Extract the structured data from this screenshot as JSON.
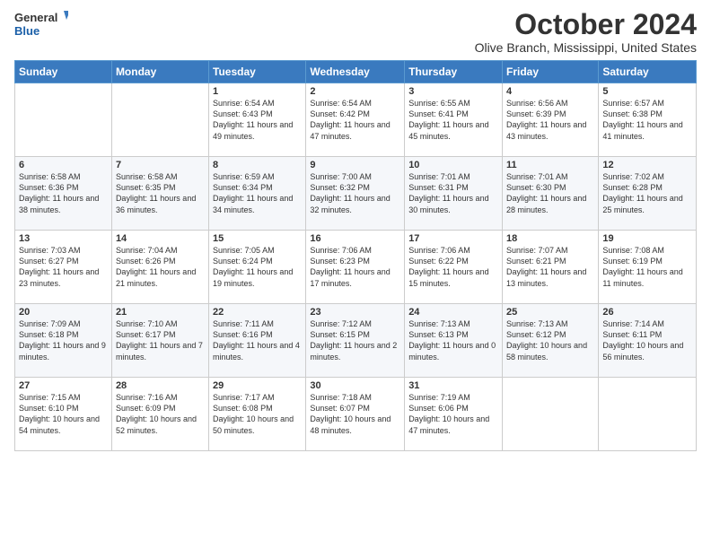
{
  "header": {
    "logo_line1": "General",
    "logo_line2": "Blue",
    "month": "October 2024",
    "location": "Olive Branch, Mississippi, United States"
  },
  "weekdays": [
    "Sunday",
    "Monday",
    "Tuesday",
    "Wednesday",
    "Thursday",
    "Friday",
    "Saturday"
  ],
  "weeks": [
    [
      {
        "day": "",
        "sunrise": "",
        "sunset": "",
        "daylight": ""
      },
      {
        "day": "",
        "sunrise": "",
        "sunset": "",
        "daylight": ""
      },
      {
        "day": "1",
        "sunrise": "Sunrise: 6:54 AM",
        "sunset": "Sunset: 6:43 PM",
        "daylight": "Daylight: 11 hours and 49 minutes."
      },
      {
        "day": "2",
        "sunrise": "Sunrise: 6:54 AM",
        "sunset": "Sunset: 6:42 PM",
        "daylight": "Daylight: 11 hours and 47 minutes."
      },
      {
        "day": "3",
        "sunrise": "Sunrise: 6:55 AM",
        "sunset": "Sunset: 6:41 PM",
        "daylight": "Daylight: 11 hours and 45 minutes."
      },
      {
        "day": "4",
        "sunrise": "Sunrise: 6:56 AM",
        "sunset": "Sunset: 6:39 PM",
        "daylight": "Daylight: 11 hours and 43 minutes."
      },
      {
        "day": "5",
        "sunrise": "Sunrise: 6:57 AM",
        "sunset": "Sunset: 6:38 PM",
        "daylight": "Daylight: 11 hours and 41 minutes."
      }
    ],
    [
      {
        "day": "6",
        "sunrise": "Sunrise: 6:58 AM",
        "sunset": "Sunset: 6:36 PM",
        "daylight": "Daylight: 11 hours and 38 minutes."
      },
      {
        "day": "7",
        "sunrise": "Sunrise: 6:58 AM",
        "sunset": "Sunset: 6:35 PM",
        "daylight": "Daylight: 11 hours and 36 minutes."
      },
      {
        "day": "8",
        "sunrise": "Sunrise: 6:59 AM",
        "sunset": "Sunset: 6:34 PM",
        "daylight": "Daylight: 11 hours and 34 minutes."
      },
      {
        "day": "9",
        "sunrise": "Sunrise: 7:00 AM",
        "sunset": "Sunset: 6:32 PM",
        "daylight": "Daylight: 11 hours and 32 minutes."
      },
      {
        "day": "10",
        "sunrise": "Sunrise: 7:01 AM",
        "sunset": "Sunset: 6:31 PM",
        "daylight": "Daylight: 11 hours and 30 minutes."
      },
      {
        "day": "11",
        "sunrise": "Sunrise: 7:01 AM",
        "sunset": "Sunset: 6:30 PM",
        "daylight": "Daylight: 11 hours and 28 minutes."
      },
      {
        "day": "12",
        "sunrise": "Sunrise: 7:02 AM",
        "sunset": "Sunset: 6:28 PM",
        "daylight": "Daylight: 11 hours and 25 minutes."
      }
    ],
    [
      {
        "day": "13",
        "sunrise": "Sunrise: 7:03 AM",
        "sunset": "Sunset: 6:27 PM",
        "daylight": "Daylight: 11 hours and 23 minutes."
      },
      {
        "day": "14",
        "sunrise": "Sunrise: 7:04 AM",
        "sunset": "Sunset: 6:26 PM",
        "daylight": "Daylight: 11 hours and 21 minutes."
      },
      {
        "day": "15",
        "sunrise": "Sunrise: 7:05 AM",
        "sunset": "Sunset: 6:24 PM",
        "daylight": "Daylight: 11 hours and 19 minutes."
      },
      {
        "day": "16",
        "sunrise": "Sunrise: 7:06 AM",
        "sunset": "Sunset: 6:23 PM",
        "daylight": "Daylight: 11 hours and 17 minutes."
      },
      {
        "day": "17",
        "sunrise": "Sunrise: 7:06 AM",
        "sunset": "Sunset: 6:22 PM",
        "daylight": "Daylight: 11 hours and 15 minutes."
      },
      {
        "day": "18",
        "sunrise": "Sunrise: 7:07 AM",
        "sunset": "Sunset: 6:21 PM",
        "daylight": "Daylight: 11 hours and 13 minutes."
      },
      {
        "day": "19",
        "sunrise": "Sunrise: 7:08 AM",
        "sunset": "Sunset: 6:19 PM",
        "daylight": "Daylight: 11 hours and 11 minutes."
      }
    ],
    [
      {
        "day": "20",
        "sunrise": "Sunrise: 7:09 AM",
        "sunset": "Sunset: 6:18 PM",
        "daylight": "Daylight: 11 hours and 9 minutes."
      },
      {
        "day": "21",
        "sunrise": "Sunrise: 7:10 AM",
        "sunset": "Sunset: 6:17 PM",
        "daylight": "Daylight: 11 hours and 7 minutes."
      },
      {
        "day": "22",
        "sunrise": "Sunrise: 7:11 AM",
        "sunset": "Sunset: 6:16 PM",
        "daylight": "Daylight: 11 hours and 4 minutes."
      },
      {
        "day": "23",
        "sunrise": "Sunrise: 7:12 AM",
        "sunset": "Sunset: 6:15 PM",
        "daylight": "Daylight: 11 hours and 2 minutes."
      },
      {
        "day": "24",
        "sunrise": "Sunrise: 7:13 AM",
        "sunset": "Sunset: 6:13 PM",
        "daylight": "Daylight: 11 hours and 0 minutes."
      },
      {
        "day": "25",
        "sunrise": "Sunrise: 7:13 AM",
        "sunset": "Sunset: 6:12 PM",
        "daylight": "Daylight: 10 hours and 58 minutes."
      },
      {
        "day": "26",
        "sunrise": "Sunrise: 7:14 AM",
        "sunset": "Sunset: 6:11 PM",
        "daylight": "Daylight: 10 hours and 56 minutes."
      }
    ],
    [
      {
        "day": "27",
        "sunrise": "Sunrise: 7:15 AM",
        "sunset": "Sunset: 6:10 PM",
        "daylight": "Daylight: 10 hours and 54 minutes."
      },
      {
        "day": "28",
        "sunrise": "Sunrise: 7:16 AM",
        "sunset": "Sunset: 6:09 PM",
        "daylight": "Daylight: 10 hours and 52 minutes."
      },
      {
        "day": "29",
        "sunrise": "Sunrise: 7:17 AM",
        "sunset": "Sunset: 6:08 PM",
        "daylight": "Daylight: 10 hours and 50 minutes."
      },
      {
        "day": "30",
        "sunrise": "Sunrise: 7:18 AM",
        "sunset": "Sunset: 6:07 PM",
        "daylight": "Daylight: 10 hours and 48 minutes."
      },
      {
        "day": "31",
        "sunrise": "Sunrise: 7:19 AM",
        "sunset": "Sunset: 6:06 PM",
        "daylight": "Daylight: 10 hours and 47 minutes."
      },
      {
        "day": "",
        "sunrise": "",
        "sunset": "",
        "daylight": ""
      },
      {
        "day": "",
        "sunrise": "",
        "sunset": "",
        "daylight": ""
      }
    ]
  ]
}
